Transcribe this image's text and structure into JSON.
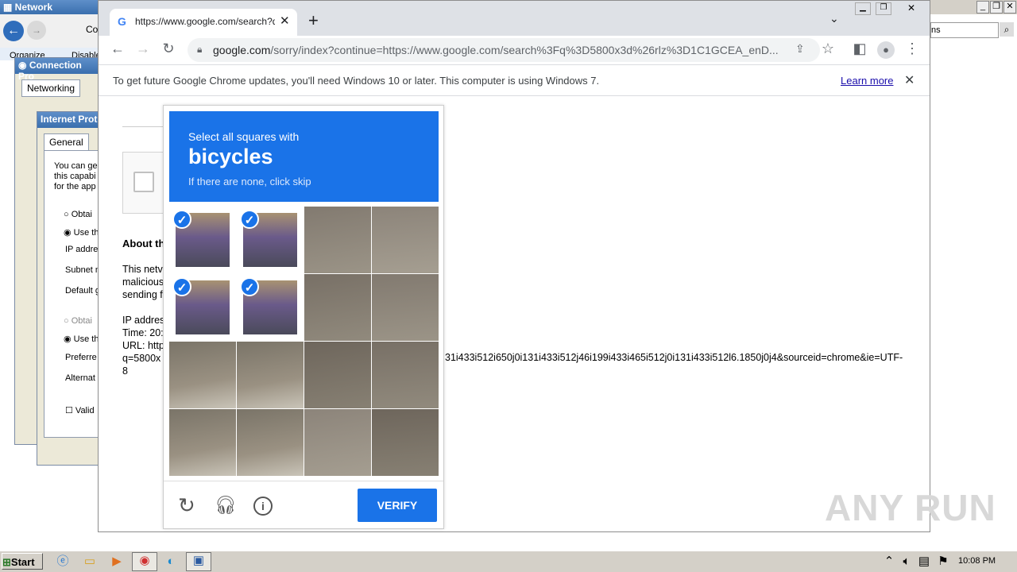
{
  "background": {
    "network_title": "Network Connectio",
    "conn_props_title": "Connection Pro",
    "networking_tab": "Networking",
    "ip_title": "Internet Prot",
    "general_tab": "General",
    "organize": "Organize",
    "disable": "Disable",
    "co": "Co",
    "ns_search": "ns",
    "line1": "You can ge",
    "line2": "this capabi",
    "line3": "for the app",
    "obtain1": "Obtai",
    "use1": "Use th",
    "ip_label": "IP addre",
    "subnet_label": "Subnet n",
    "default_label": "Default g",
    "obtain2": "Obtai",
    "use2": "Use th",
    "pref_label": "Preferre",
    "alt_label": "Alternat",
    "valid_label": "Valid"
  },
  "chrome": {
    "tab_title": "https://www.google.com/search?q=",
    "url_domain": "google.com",
    "url_path": "/sorry/index?continue=https://www.google.com/search%3Fq%3D5800x3d%26rlz%3D1C1GCEA_enD...",
    "infobar_text": "To get future Google Chrome updates, you'll need Windows 10 or later. This computer is using Windows 7.",
    "learn_more": "Learn more"
  },
  "sorry_page": {
    "about_heading": "About th",
    "para1": "This netv",
    "para2": "malicious",
    "para3": "sending f",
    "ip_line": "IP addres",
    "time_line": "Time: 20:",
    "url_line": "URL: http",
    "q_line": "q=5800x",
    "url_tail": "31i433i512i650j0i131i433i512j46i199i433i465i512j0i131i433i512l6.1850j0j4&sourceid=chrome&ie=UTF-",
    "url_end": "8"
  },
  "captcha": {
    "instruction": "Select all squares with",
    "object": "bicycles",
    "skip_hint": "If there are none, click skip",
    "verify_label": "VERIFY",
    "selected_cells": [
      0,
      1,
      4,
      5
    ]
  },
  "taskbar": {
    "start_label": "Start",
    "clock": "10:08 PM"
  },
  "watermark": "ANY RUN"
}
